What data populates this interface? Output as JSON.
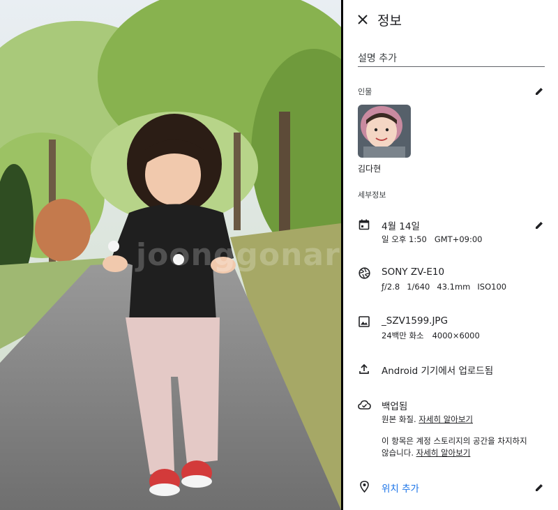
{
  "panel": {
    "title": "정보",
    "description_placeholder": "설명 추가"
  },
  "people": {
    "section_label": "인물",
    "person_name": "김다현"
  },
  "details": {
    "section_label": "세부정보",
    "date": {
      "primary": "4월 14일",
      "secondary": "일 오후 1:50   GMT+09:00"
    },
    "camera": {
      "model": "SONY ZV-E10",
      "aperture": "ƒ/2.8",
      "shutter": "1/640",
      "focal_length": "43.1mm",
      "iso": "ISO100"
    },
    "file": {
      "name": "_SZV1599.JPG",
      "megapixels": "24백만 화소",
      "resolution": "4000×6000"
    },
    "upload": {
      "text": "Android 기기에서 업로드됨"
    },
    "backup": {
      "title": "백업됨",
      "quality_prefix": "원본 화질.",
      "quality_link": "자세히 알아보기",
      "storage_note_line1": "이 항목은 계정 스토리지의 공간을 차지하지",
      "storage_note_line2": "않습니다.",
      "storage_link": "자세히 알아보기"
    },
    "location": {
      "add_label": "위치 추가"
    }
  },
  "photo": {
    "watermark": "joonggonara"
  },
  "colors": {
    "accent_link": "#1a73e8",
    "divider": "#000000",
    "text": "#202124"
  }
}
